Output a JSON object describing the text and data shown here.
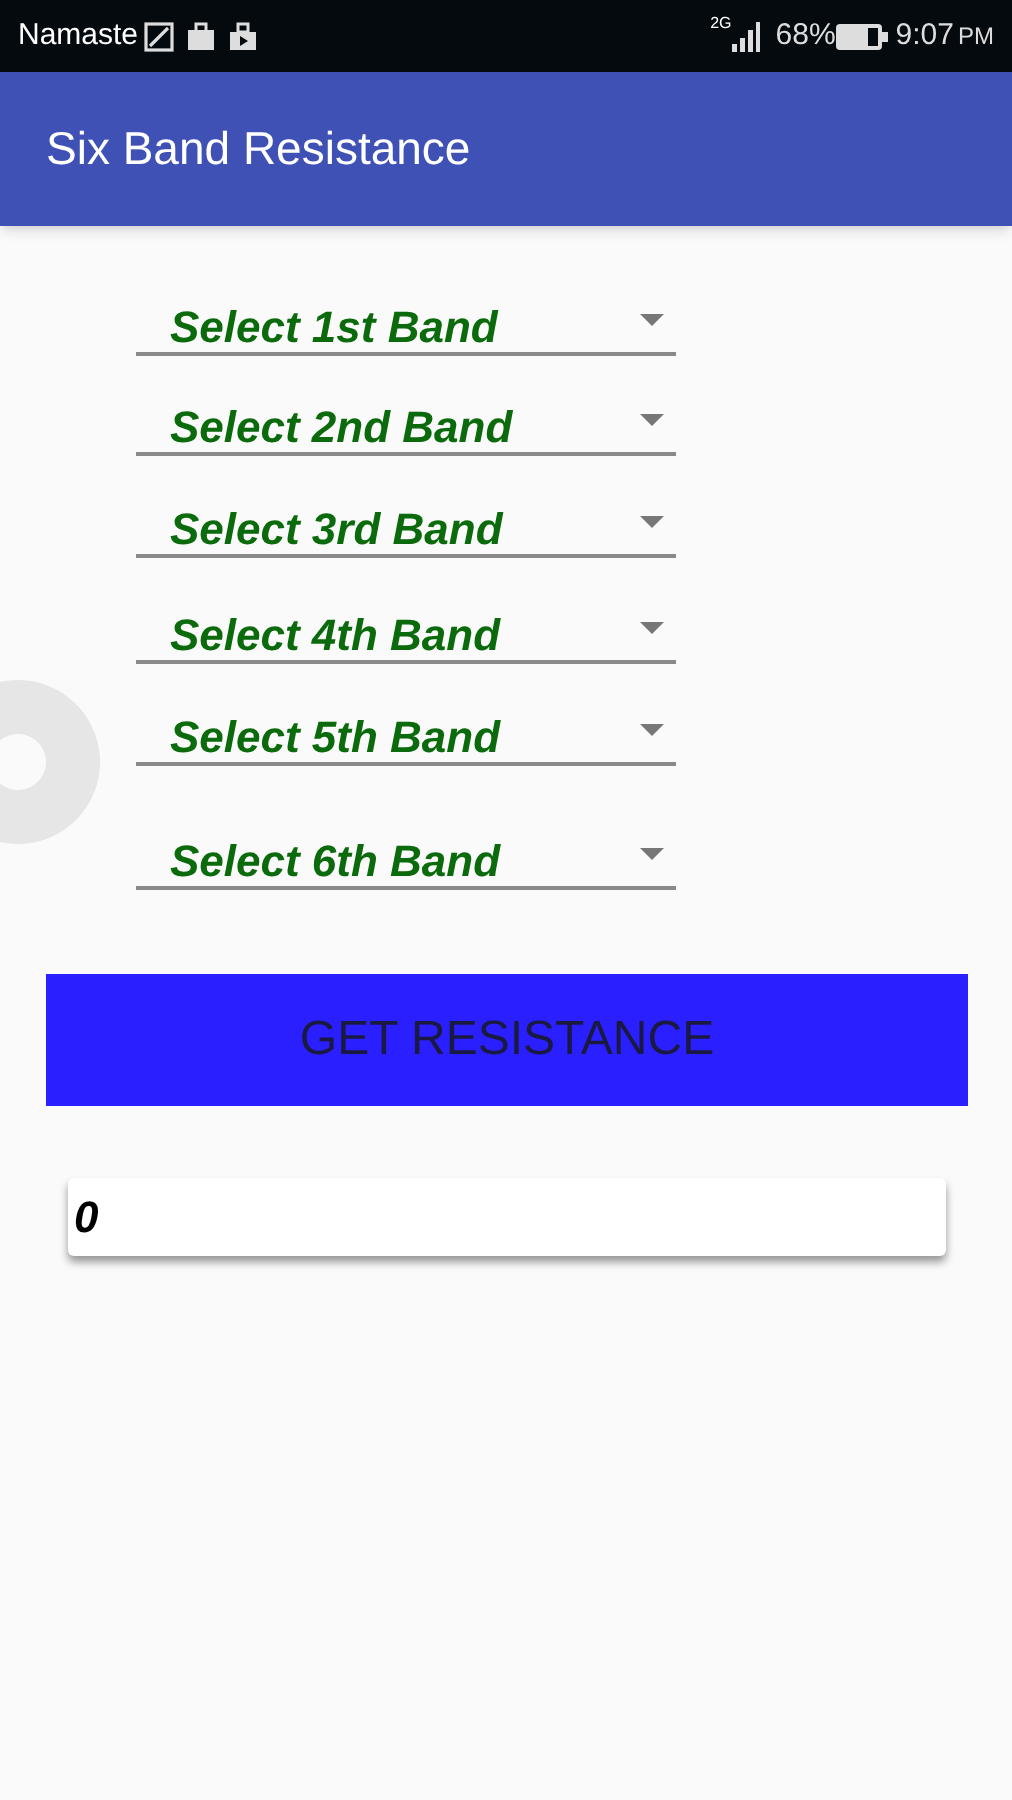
{
  "status_bar": {
    "carrier": "Namaste",
    "network": "2G",
    "battery": "68%",
    "time": "9:07",
    "ampm": "PM"
  },
  "app_bar": {
    "title": "Six Band Resistance"
  },
  "spinners": [
    {
      "label": "Select 1st Band"
    },
    {
      "label": "Select 2nd Band"
    },
    {
      "label": "Select 3rd Band"
    },
    {
      "label": "Select 4th Band"
    },
    {
      "label": "Select 5th Band"
    },
    {
      "label": "Select 6th Band"
    }
  ],
  "button": {
    "label": "GET RESISTANCE"
  },
  "result": {
    "value": "0"
  }
}
